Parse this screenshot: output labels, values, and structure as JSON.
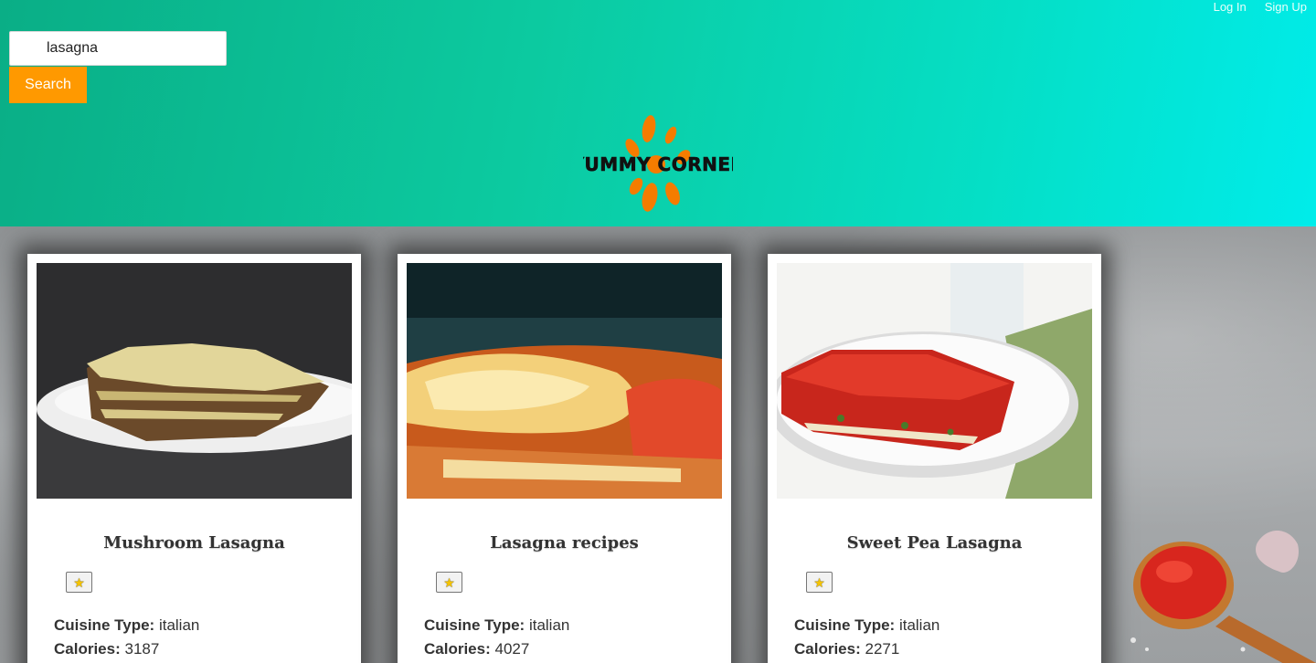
{
  "nav": {
    "login": "Log In",
    "signup": "Sign Up"
  },
  "search": {
    "value": "lasagna",
    "button": "Search"
  },
  "logo": {
    "text": "YUMMY CORNER",
    "petal_color": "#f57c00"
  },
  "colors": {
    "header_start": "#0aae86",
    "header_end": "#00ecea",
    "accent": "#ff9900"
  },
  "labels": {
    "cuisine": "Cuisine Type:",
    "calories": "Calories:"
  },
  "favorite_icon": "star-icon",
  "recipes": [
    {
      "title": "Mushroom Lasagna",
      "cuisine": "italian",
      "calories": "3187"
    },
    {
      "title": "Lasagna recipes",
      "cuisine": "italian",
      "calories": "4027"
    },
    {
      "title": "Sweet Pea Lasagna",
      "cuisine": "italian",
      "calories": "2271"
    }
  ]
}
